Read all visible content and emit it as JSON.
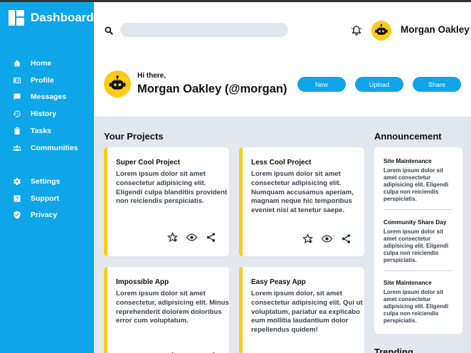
{
  "brand": {
    "title": "Dashboard",
    "icon": "dashboard-grid-icon"
  },
  "sidebar": {
    "items": [
      {
        "label": "Home",
        "icon": "home-icon"
      },
      {
        "label": "Profile",
        "icon": "id-card-icon"
      },
      {
        "label": "Messages",
        "icon": "chat-icon"
      },
      {
        "label": "History",
        "icon": "history-icon"
      },
      {
        "label": "Tasks",
        "icon": "clipboard-icon"
      },
      {
        "label": "Communities",
        "icon": "users-icon"
      }
    ],
    "secondary_items": [
      {
        "label": "Settings",
        "icon": "gear-icon"
      },
      {
        "label": "Support",
        "icon": "question-icon"
      },
      {
        "label": "Privacy",
        "icon": "shield-icon"
      }
    ]
  },
  "topbar": {
    "search_placeholder": "",
    "username": "Morgan Oakley"
  },
  "greeting": {
    "hi": "Hi there,",
    "name": "Morgan Oakley (@morgan)",
    "buttons": {
      "new": "New",
      "upload": "Upload",
      "share": "Share"
    }
  },
  "projects": {
    "title": "Your Projects",
    "items": [
      {
        "title": "Super Cool Project",
        "body": "Lorem ipsum dolor sit amet consectetur adipisicing elit. Eligendi culpa blanditiis provident non reiciendis perspiciatis."
      },
      {
        "title": "Less Cool Project",
        "body": "Lorem ipsum dolor sit amet consectetur adipisicing elit. Numquam accusamus aperiam, magnam neque hic temporibus eveniet nisi at tenetur saepe."
      },
      {
        "title": "Impossible App",
        "body": "Lorem ipsum dolor sit amet consectetur, adipisicing elit. Minus reprehenderit dolorem doloribus error cum voluptatum."
      },
      {
        "title": "Easy Peasy App",
        "body": "Lorem ipsum dolor, sit amet consectetur adipisicing elit. Qui ut voluptatum, pariatur ea explicabo eum mollitia laudantium dolor repellendus quidem!"
      }
    ]
  },
  "announcements": {
    "title": "Announcement",
    "items": [
      {
        "title": "Site Maintenance",
        "body": "Lorem ipsum dolor sit amet consectetur adipisicing elit. Eligendi culpa non reiciendis perspiciatis."
      },
      {
        "title": "Community Share Day",
        "body": "Lorem ipsum dolor sit amet consectetur adipisicing elit. Eligendi culpa non reiciendis perspiciatis."
      },
      {
        "title": "Site Maintenance",
        "body": "Lorem ipsum dolor sit amet consectetur adipisicing elit. Eligendi culpa non reiciendis perspiciatis."
      }
    ]
  },
  "trending": {
    "title": "Trending"
  },
  "colors": {
    "sidebar": "#0ea5e9",
    "accent": "#facc15",
    "background": "#e2e8f0"
  }
}
